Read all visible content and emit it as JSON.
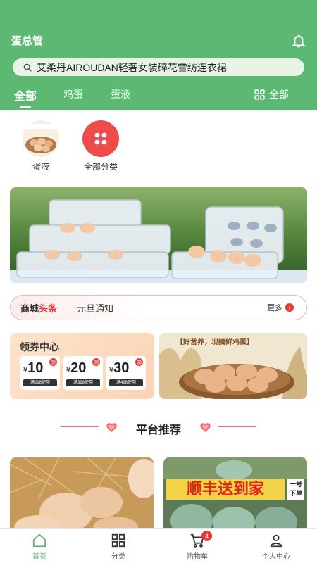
{
  "header": {
    "title": "蛋总管",
    "search_text": "艾柔丹AIROUDAN轻奢女装碎花雪纺连衣裙",
    "tabs": [
      "全部",
      "鸡蛋",
      "蛋液"
    ],
    "all_label": "全部"
  },
  "categories": [
    {
      "label": "蛋液",
      "icon": "egg-liquid-image"
    },
    {
      "label": "全部分类",
      "icon": "grid-icon"
    }
  ],
  "notice": {
    "brand_black": "商城",
    "brand_red": "头条",
    "text": "元旦通知",
    "more": "更多"
  },
  "coupons": {
    "title": "领券中心",
    "items": [
      {
        "currency": "¥",
        "amount": "10",
        "tag": "领",
        "condition": "满298使用"
      },
      {
        "currency": "¥",
        "amount": "20",
        "tag": "领",
        "condition": "满398使用"
      },
      {
        "currency": "¥",
        "amount": "30",
        "tag": "领",
        "condition": "满498使用"
      }
    ]
  },
  "promo": {
    "text": "【好营养，现摘鲜鸡蛋】"
  },
  "recommend": {
    "title": "平台推荐"
  },
  "products": [
    {
      "image": "eggs-in-straw"
    },
    {
      "image": "green-eggs",
      "overlay_text": "顺丰送到家",
      "side_text": "一号下单"
    }
  ],
  "tabbar": {
    "items": [
      {
        "label": "首页",
        "icon": "home-icon",
        "active": true
      },
      {
        "label": "分类",
        "icon": "category-icon"
      },
      {
        "label": "购物车",
        "icon": "cart-icon",
        "badge": "4"
      },
      {
        "label": "个人中心",
        "icon": "user-icon"
      }
    ]
  },
  "colors": {
    "primary": "#5db873",
    "accent_red": "#e53935"
  }
}
